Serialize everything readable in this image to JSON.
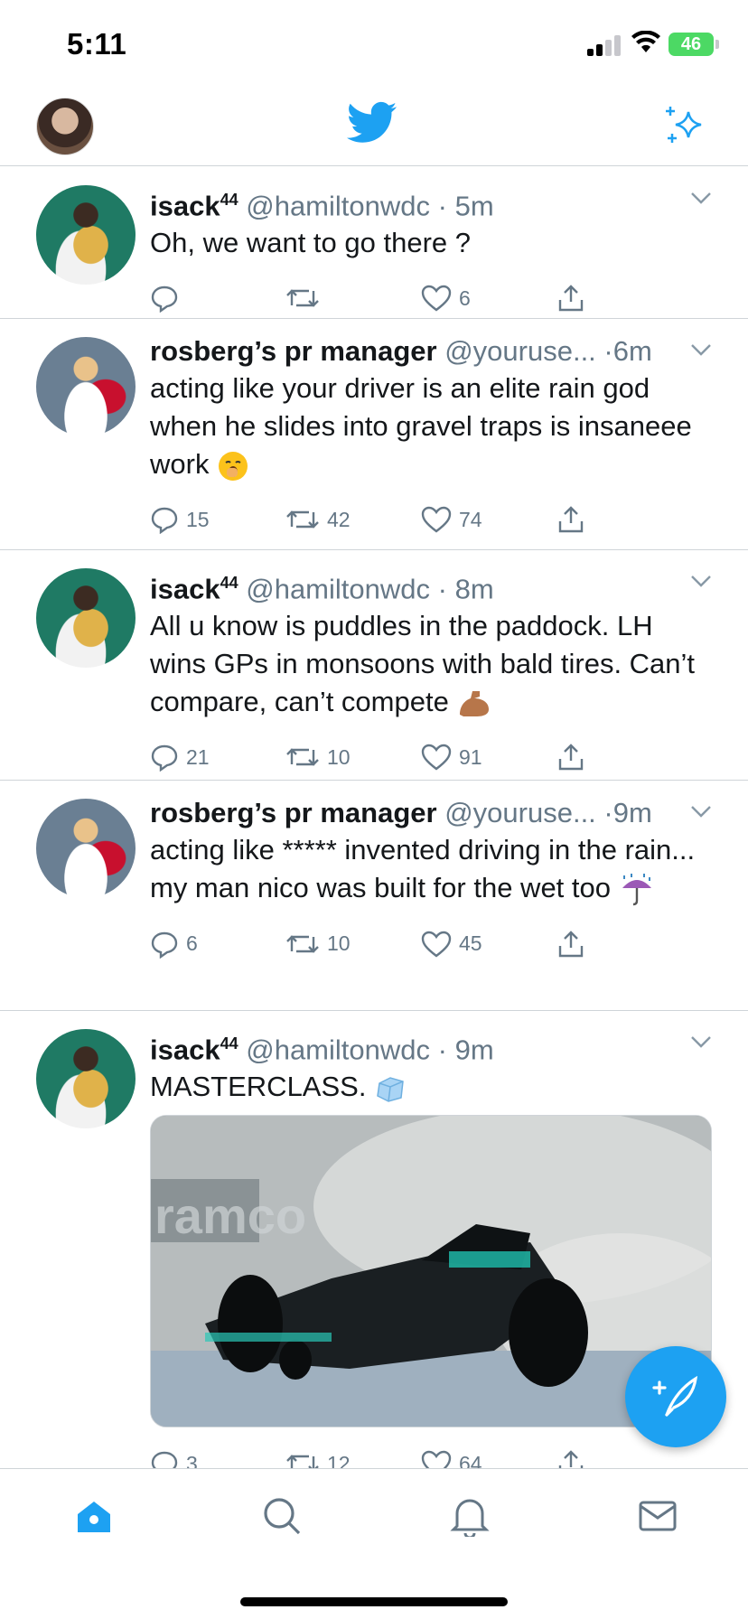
{
  "status_bar": {
    "time": "5:11",
    "battery": "46"
  },
  "colors": {
    "accent": "#1da1f2",
    "secondary_text": "#657786",
    "divider": "#cfd4d8"
  },
  "top_nav": {
    "logo_icon": "twitter-bird-icon",
    "right_icon": "sparkle-icon"
  },
  "tweets": [
    {
      "name": "isack",
      "name_sup": "44",
      "handle": "@hamiltonwdc",
      "dot": "·",
      "time": "5m",
      "text": "Oh, we want to go there ?",
      "emoji": "",
      "replies": "",
      "retweets": "",
      "likes": "6"
    },
    {
      "name": "rosberg’s pr manager",
      "name_sup": "",
      "handle": "@youruse...",
      "dot": "·",
      "time": "6m",
      "text": "acting like your driver is an elite rain god when he slides into gravel traps is insaneee work",
      "emoji": "yawning-face-emoji",
      "replies": "15",
      "retweets": "42",
      "likes": "74"
    },
    {
      "name": "isack",
      "name_sup": "44",
      "handle": "@hamiltonwdc",
      "dot": "·",
      "time": "8m",
      "text": "All u know is puddles in the paddock. LH wins GPs in monsoons with bald tires. Can’t compare, can’t compete",
      "emoji": "flexed-biceps-emoji",
      "replies": "21",
      "retweets": "10",
      "likes": "91"
    },
    {
      "name": "rosberg’s pr manager",
      "name_sup": "",
      "handle": "@youruse...",
      "dot": "·",
      "time": "9m",
      "text": "acting like ***** invented driving in the rain... my man nico was built for the wet too",
      "emoji": "umbrella-rain-emoji",
      "replies": "6",
      "retweets": "10",
      "likes": "45"
    },
    {
      "name": "isack",
      "name_sup": "44",
      "handle": "@hamiltonwdc",
      "dot": "·",
      "time": "9m",
      "text": "MASTERCLASS.",
      "emoji": "ice-cube-emoji",
      "replies": "3",
      "retweets": "12",
      "likes": "64",
      "media_caption": "ramco"
    }
  ],
  "tab_bar": [
    "home-icon",
    "search-icon",
    "notifications-icon",
    "messages-icon"
  ]
}
